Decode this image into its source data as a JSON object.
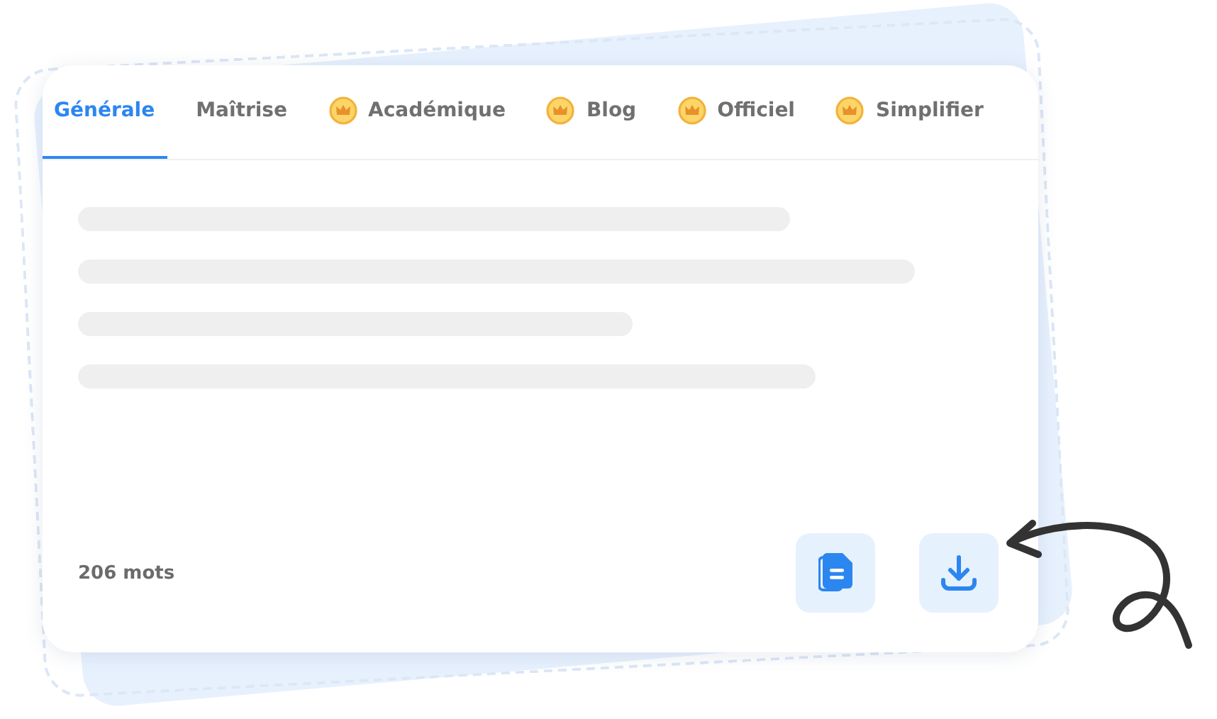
{
  "tabs": [
    {
      "label": "Générale",
      "premium": false,
      "selected": true
    },
    {
      "label": "Maîtrise",
      "premium": false,
      "selected": false
    },
    {
      "label": "Académique",
      "premium": true,
      "selected": false
    },
    {
      "label": "Blog",
      "premium": true,
      "selected": false
    },
    {
      "label": "Officiel",
      "premium": true,
      "selected": false
    },
    {
      "label": "Simplifier",
      "premium": true,
      "selected": false
    }
  ],
  "word_count": "206 mots",
  "actions": [
    {
      "kind": "copy"
    },
    {
      "kind": "download"
    }
  ]
}
